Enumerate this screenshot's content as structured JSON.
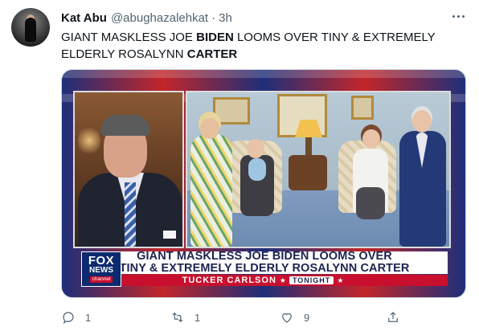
{
  "tweet": {
    "author_name": "Kat Abu",
    "author_handle": "@abughazalehkat",
    "separator": "·",
    "timestamp": "3h",
    "text_segments": [
      {
        "text": "GIANT MASKLESS JOE ",
        "bold": false
      },
      {
        "text": "BIDEN",
        "bold": true
      },
      {
        "text": " LOOMS OVER TINY & EXTREMELY ELDERLY ROSALYNN ",
        "bold": false
      },
      {
        "text": "CARTER",
        "bold": true
      }
    ]
  },
  "media": {
    "chyron_line1": "GIANT MASKLESS JOE BIDEN LOOMS OVER",
    "chyron_line2": "TINY & EXTREMELY ELDERLY ROSALYNN CARTER",
    "show_name": "TUCKER CARLSON",
    "show_badge": "TONIGHT",
    "logo_fox": "FOX",
    "logo_news": "NEWS",
    "logo_channel": "channel"
  },
  "actions": {
    "reply_count": "1",
    "retweet_count": "1",
    "like_count": "9",
    "icons": [
      "reply-icon",
      "retweet-icon",
      "like-icon",
      "share-icon"
    ]
  },
  "colors": {
    "text_primary": "#0f1419",
    "text_secondary": "#536471",
    "fox_red": "#c8102e",
    "fox_blue": "#0b2a6f"
  }
}
